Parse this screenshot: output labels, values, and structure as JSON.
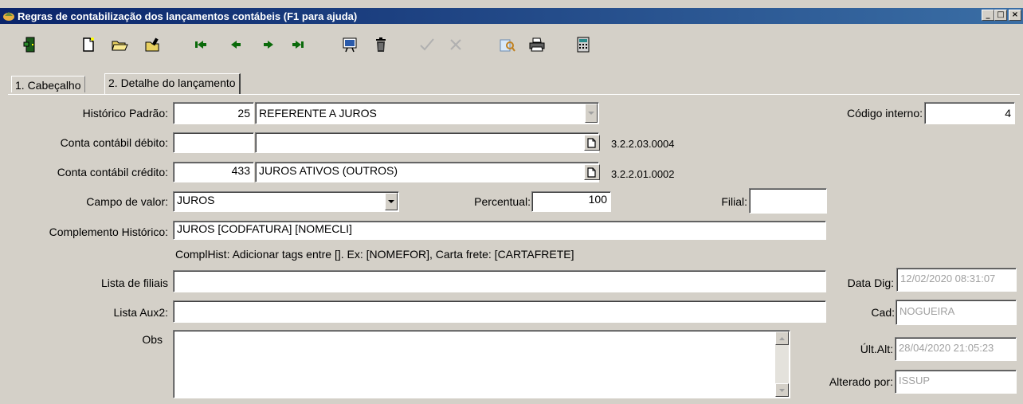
{
  "window": {
    "title": "Regras de contabilização dos lançamentos contábeis (F1 para ajuda)",
    "controls": [
      "_",
      "□",
      "×"
    ]
  },
  "toolbar": {
    "buttons": [
      "exit-door-icon",
      "new-document-icon",
      "open-folder-icon",
      "folder-edit-icon",
      "first-record-icon",
      "previous-record-icon",
      "next-record-icon",
      "last-record-icon",
      "preview-icon",
      "delete-trash-icon",
      "confirm-check-icon",
      "cancel-x-icon",
      "search-icon",
      "print-icon",
      "calculator-icon"
    ]
  },
  "tabs": [
    {
      "label": "1. Cabeçalho",
      "active": false
    },
    {
      "label": "2. Detalhe do lançamento",
      "active": true
    }
  ],
  "form": {
    "historico_padrao": {
      "label": "Histórico Padrão:",
      "code": "25",
      "text": "REFERENTE A JUROS"
    },
    "codigo_interno": {
      "label": "Código interno:",
      "value": "4"
    },
    "conta_debito": {
      "label": "Conta contábil débito:",
      "code": "",
      "text": "",
      "account": "3.2.2.03.0004"
    },
    "conta_credito": {
      "label": "Conta contábil crédito:",
      "code": "433",
      "text": "JUROS ATIVOS (OUTROS)",
      "account": "3.2.2.01.0002"
    },
    "campo_valor": {
      "label": "Campo de valor:",
      "value": "JUROS"
    },
    "percentual": {
      "label": "Percentual:",
      "value": "100"
    },
    "filial": {
      "label": "Filial:",
      "value": ""
    },
    "complemento": {
      "label": "Complemento Histórico:",
      "value": "JUROS [CODFATURA] [NOMECLI]"
    },
    "hint": "ComplHist: Adicionar tags entre []. Ex: [NOMEFOR], Carta frete: [CARTAFRETE]",
    "lista_filiais": {
      "label": "Lista de filiais",
      "value": ""
    },
    "lista_aux2": {
      "label": "Lista Aux2:",
      "value": ""
    },
    "obs": {
      "label": "Obs",
      "value": ""
    },
    "data_dig": {
      "label": "Data Dig:",
      "value": "12/02/2020 08:31:07"
    },
    "cad": {
      "label": "Cad:",
      "value": "NOGUEIRA"
    },
    "ult_alt": {
      "label": "Últ.Alt:",
      "value": "28/04/2020 21:05:23"
    },
    "alterado_por": {
      "label": "Alterado por:",
      "value": "ISSUP"
    }
  },
  "colors": {
    "titlebar_start": "#0a246a",
    "titlebar_end": "#3a6ea5",
    "face": "#d4d0c8"
  }
}
